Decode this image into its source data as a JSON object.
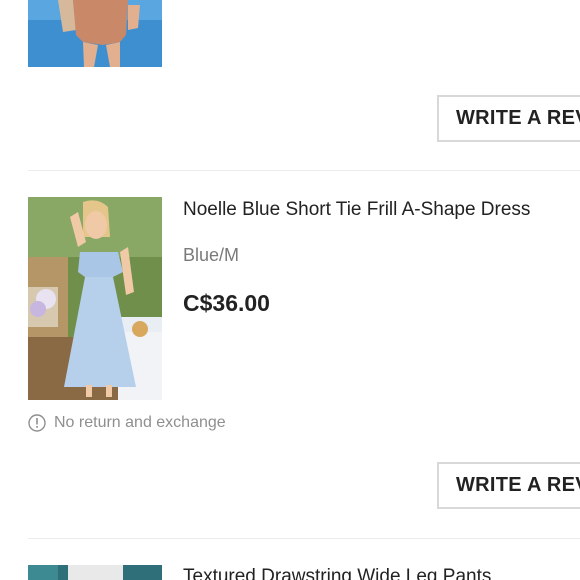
{
  "order_items": [
    {
      "image": "romper-photo",
      "review_button_label": "WRITE A REVIEW"
    },
    {
      "image": "blue-dress-photo",
      "name": "Noelle Blue Short Tie Frill A-Shape Dress",
      "variant": "Blue/M",
      "price": "C$36.00",
      "notice": {
        "icon": "info-circle-icon",
        "text": "No return and exchange"
      },
      "review_button_label": "WRITE A REVIEW"
    },
    {
      "image": "pants-photo",
      "name": "Textured Drawstring Wide Leg Pants"
    }
  ],
  "colors": {
    "border": "#d8d8d8",
    "divider": "#ececec",
    "muted_text": "#8f8f8f",
    "primary_text": "#222222"
  }
}
